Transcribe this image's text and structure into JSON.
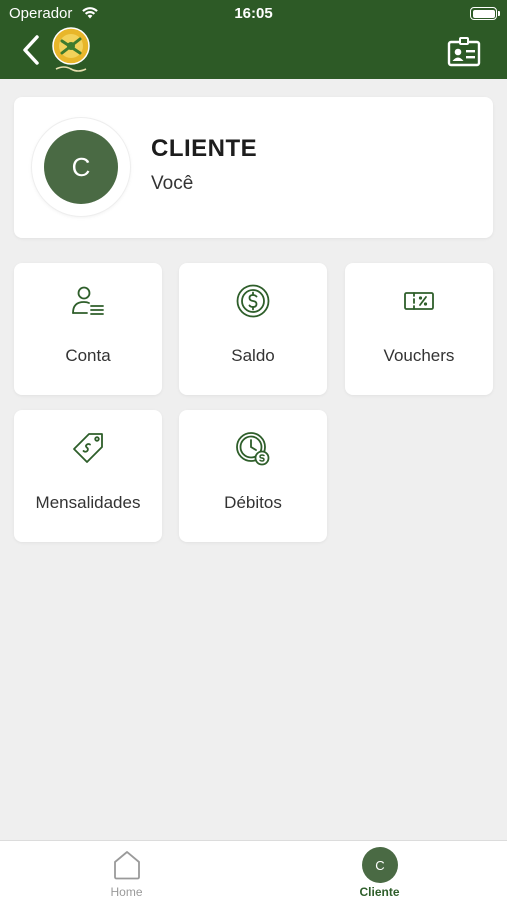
{
  "status_bar": {
    "carrier": "Operador",
    "time": "16:05"
  },
  "header": {
    "back_icon": "chevron-left-icon",
    "logo_icon": "app-logo",
    "action_icon": "id-card-icon"
  },
  "profile": {
    "initial": "C",
    "name": "CLIENTE",
    "subtitle": "Você"
  },
  "tiles": [
    {
      "label": "Conta",
      "icon": "user-list-icon"
    },
    {
      "label": "Saldo",
      "icon": "dollar-coin-icon"
    },
    {
      "label": "Vouchers",
      "icon": "voucher-ticket-icon"
    },
    {
      "label": "Mensalidades",
      "icon": "price-tag-icon"
    },
    {
      "label": "Débitos",
      "icon": "clock-dollar-icon"
    }
  ],
  "tabbar": {
    "tabs": [
      {
        "label": "Home",
        "icon": "home-icon",
        "active": false
      },
      {
        "label": "Cliente",
        "initial": "C",
        "active": true
      }
    ]
  },
  "colors": {
    "header_bg": "#2d5a26",
    "accent": "#2e5e2a",
    "avatar_bg": "#4a6a44",
    "inactive": "#9a9a9a",
    "background": "#efefef"
  }
}
